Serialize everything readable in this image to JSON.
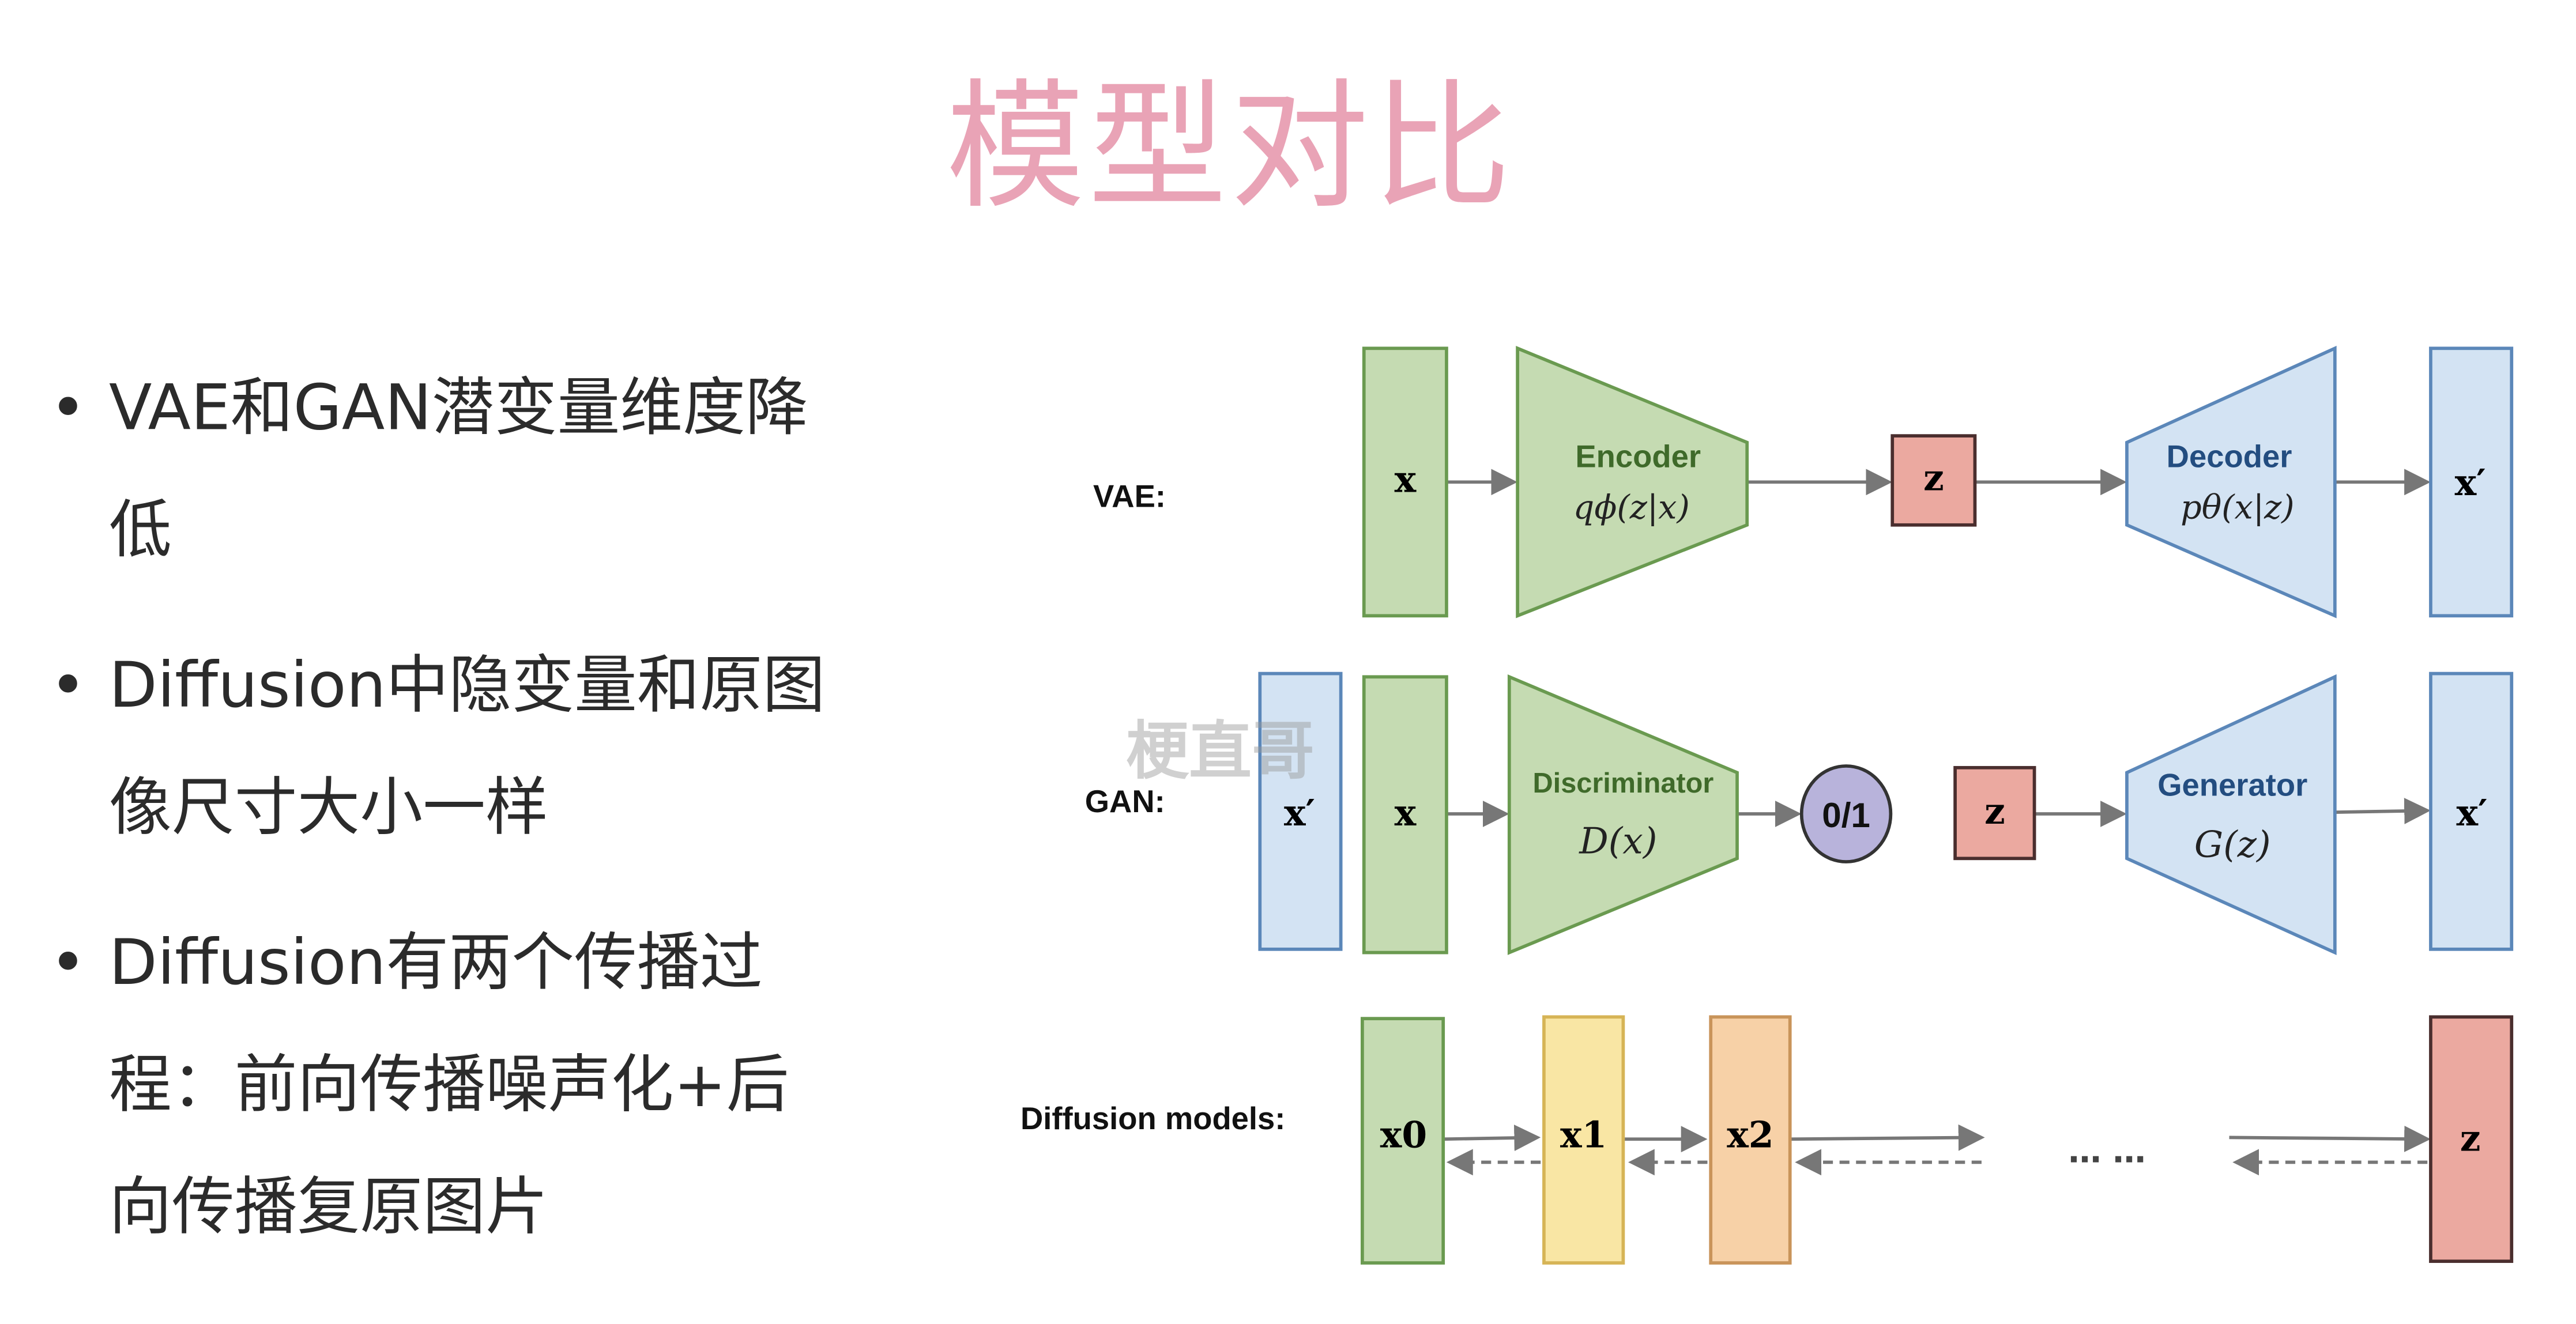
{
  "title": "模型对比",
  "bullets": [
    "VAE和GAN潜变量维度降低",
    "Diffusion中隐变量和原图像尺寸大小一样",
    "Diffusion有两个传播过程：前向传播噪声化+后向传播复原图片"
  ],
  "watermark": "梗直哥",
  "diagram": {
    "vae": {
      "label": "VAE:",
      "input": "x",
      "encoder": "Encoder",
      "encoder_formula": "qϕ(z|x)",
      "latent": "z",
      "decoder": "Decoder",
      "decoder_formula": "pθ(x|z)",
      "output": "x′"
    },
    "gan": {
      "label": "GAN:",
      "real": "x′",
      "input": "x",
      "discriminator": "Discriminator",
      "discriminator_formula": "D(x)",
      "output_class": "0/1",
      "latent": "z",
      "generator": "Generator",
      "generator_formula": "G(z)",
      "output": "x′"
    },
    "diffusion": {
      "label": "Diffusion models:",
      "x0": "x0",
      "x1": "x1",
      "x2": "x2",
      "ellipsis": "… …",
      "latent": "z"
    }
  },
  "colors": {
    "title": "#e9a3b6",
    "green": "#c5dbb2",
    "blue": "#d3e3f3",
    "red": "#eba9a0",
    "yellow": "#f9e6a4",
    "orange": "#f7d1a7",
    "purple": "#b8b3db"
  }
}
